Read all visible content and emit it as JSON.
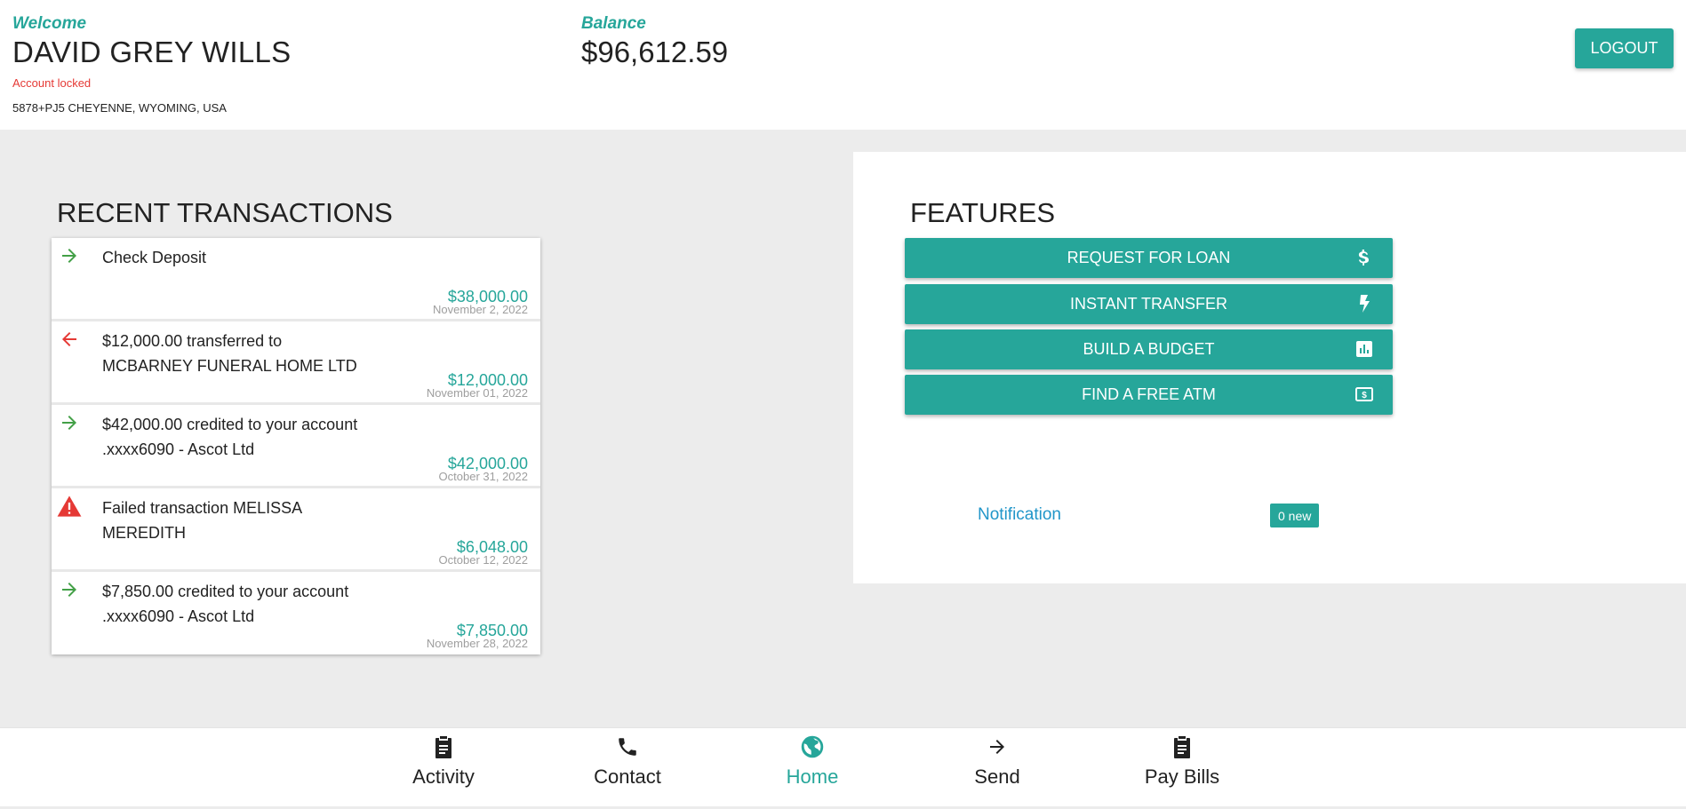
{
  "header": {
    "welcome_label": "Welcome",
    "user_name": "DAVID GREY WILLS",
    "account_status": "Account locked",
    "address": "5878+PJ5 CHEYENNE, WYOMING, USA",
    "balance_label": "Balance",
    "balance_value": "$96,612.59",
    "logout_label": "LOGOUT"
  },
  "transactions": {
    "title": "RECENT TRANSACTIONS",
    "items": [
      {
        "icon": "arrow-right-icon",
        "description": "Check Deposit",
        "amount": "$38,000.00",
        "date": "November 2, 2022"
      },
      {
        "icon": "arrow-left-icon",
        "description": "$12,000.00 transferred to MCBARNEY FUNERAL HOME LTD",
        "amount": "$12,000.00",
        "date": "November 01, 2022"
      },
      {
        "icon": "arrow-right-icon",
        "description": "$42,000.00 credited to your account .xxxx6090 - Ascot Ltd",
        "amount": "$42,000.00",
        "date": "October 31, 2022"
      },
      {
        "icon": "warning-icon",
        "description": "Failed transaction MELISSA MEREDITH",
        "amount": "$6,048.00",
        "date": "October 12, 2022"
      },
      {
        "icon": "arrow-right-icon",
        "description": "$7,850.00 credited to your account .xxxx6090 - Ascot Ltd",
        "amount": "$7,850.00",
        "date": "November 28, 2022"
      }
    ]
  },
  "features": {
    "title": "FEATURES",
    "buttons": [
      {
        "label": "REQUEST FOR LOAN",
        "icon": "dollar-icon"
      },
      {
        "label": "INSTANT TRANSFER",
        "icon": "flash-icon"
      },
      {
        "label": "BUILD A BUDGET",
        "icon": "chart-icon"
      },
      {
        "label": "FIND A FREE ATM",
        "icon": "money-icon"
      }
    ],
    "notification_label": "Notification",
    "notification_badge": "0 new"
  },
  "nav": {
    "items": [
      {
        "label": "Activity",
        "icon": "clipboard-icon",
        "active": false
      },
      {
        "label": "Contact",
        "icon": "phone-icon",
        "active": false
      },
      {
        "label": "Home",
        "icon": "globe-icon",
        "active": true
      },
      {
        "label": "Send",
        "icon": "arrow-right-icon",
        "active": false
      },
      {
        "label": "Pay Bills",
        "icon": "clipboard-icon",
        "active": false
      }
    ]
  },
  "colors": {
    "accent": "#26a69a",
    "danger": "#e53935",
    "credit_arrow": "#43a047",
    "link": "#2196c9"
  }
}
